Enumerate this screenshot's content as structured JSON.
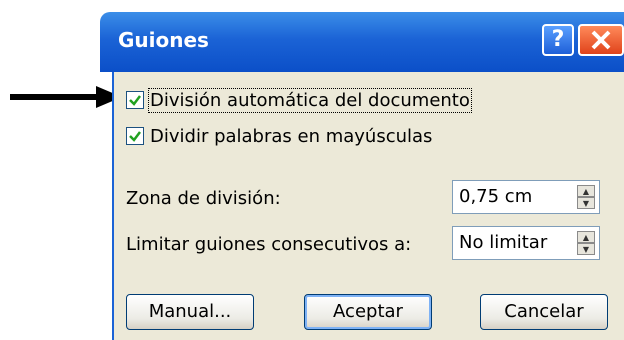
{
  "window": {
    "title": "Guiones"
  },
  "titlebar_buttons": {
    "help_icon": "?",
    "close_icon": "×"
  },
  "checkboxes": [
    {
      "label": "División automática del documento",
      "checked": true,
      "focused": true
    },
    {
      "label": "Dividir palabras en mayúsculas",
      "checked": true,
      "focused": false
    }
  ],
  "fields": {
    "hyphen_zone": {
      "label": "Zona de división:",
      "value": "0,75 cm"
    },
    "limit_hyphens": {
      "label": "Limitar guiones consecutivos a:",
      "value": "No limitar"
    }
  },
  "buttons": {
    "manual": "Manual...",
    "accept": "Aceptar",
    "cancel": "Cancelar"
  },
  "colors": {
    "titlebar": "#0b4fc8",
    "client": "#ece9d8",
    "check": "#21a121"
  }
}
